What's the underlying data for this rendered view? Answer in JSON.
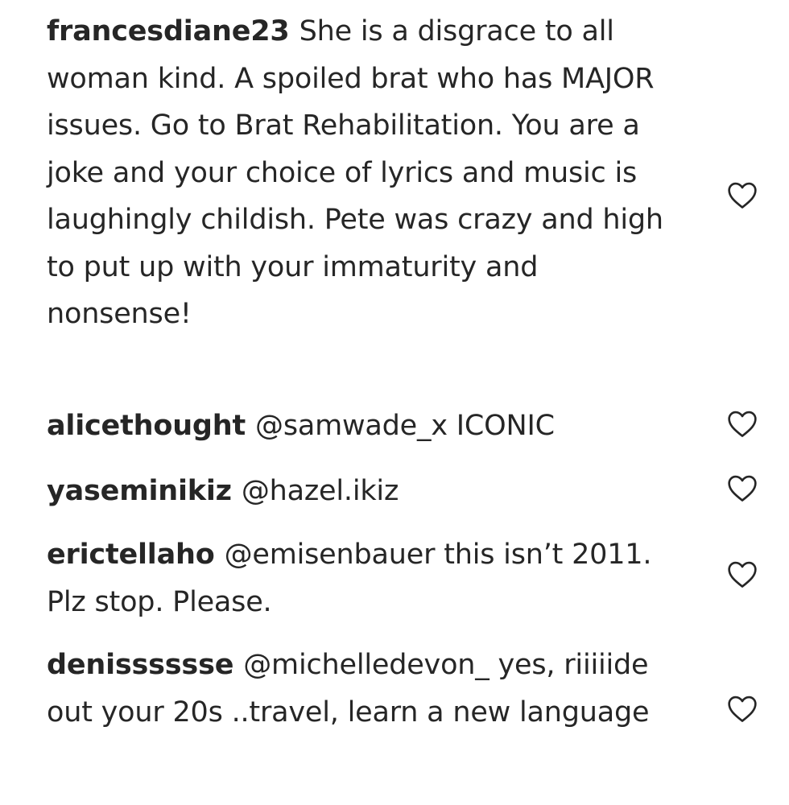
{
  "comments": [
    {
      "username": "francesdiane23",
      "text": "She is a disgrace to all woman kind. A spoiled brat who has MAJOR issues. Go to Brat Rehabilitation. You are a joke and your choice of lyrics and music is laughingly childish. Pete was crazy and high to put up with your immaturity and nonsense!",
      "like_icon": "heart-outline-icon"
    },
    {
      "username": "alicethought",
      "text": "@samwade_x ICONIC",
      "like_icon": "heart-outline-icon"
    },
    {
      "username": "yaseminikiz",
      "text": "@hazel.ikiz",
      "like_icon": "heart-outline-icon"
    },
    {
      "username": "erictellaho",
      "text": "@emisenbauer this isn’t 2011. Plz stop. Please.",
      "like_icon": "heart-outline-icon"
    },
    {
      "username": "denisssssse",
      "text": "@michelledevon_ yes, riiiiide out your 20s ..travel, learn a new language",
      "like_icon": "heart-outline-icon"
    }
  ],
  "colors": {
    "text": "#262626",
    "icon_stroke": "#262626",
    "background": "#ffffff"
  }
}
